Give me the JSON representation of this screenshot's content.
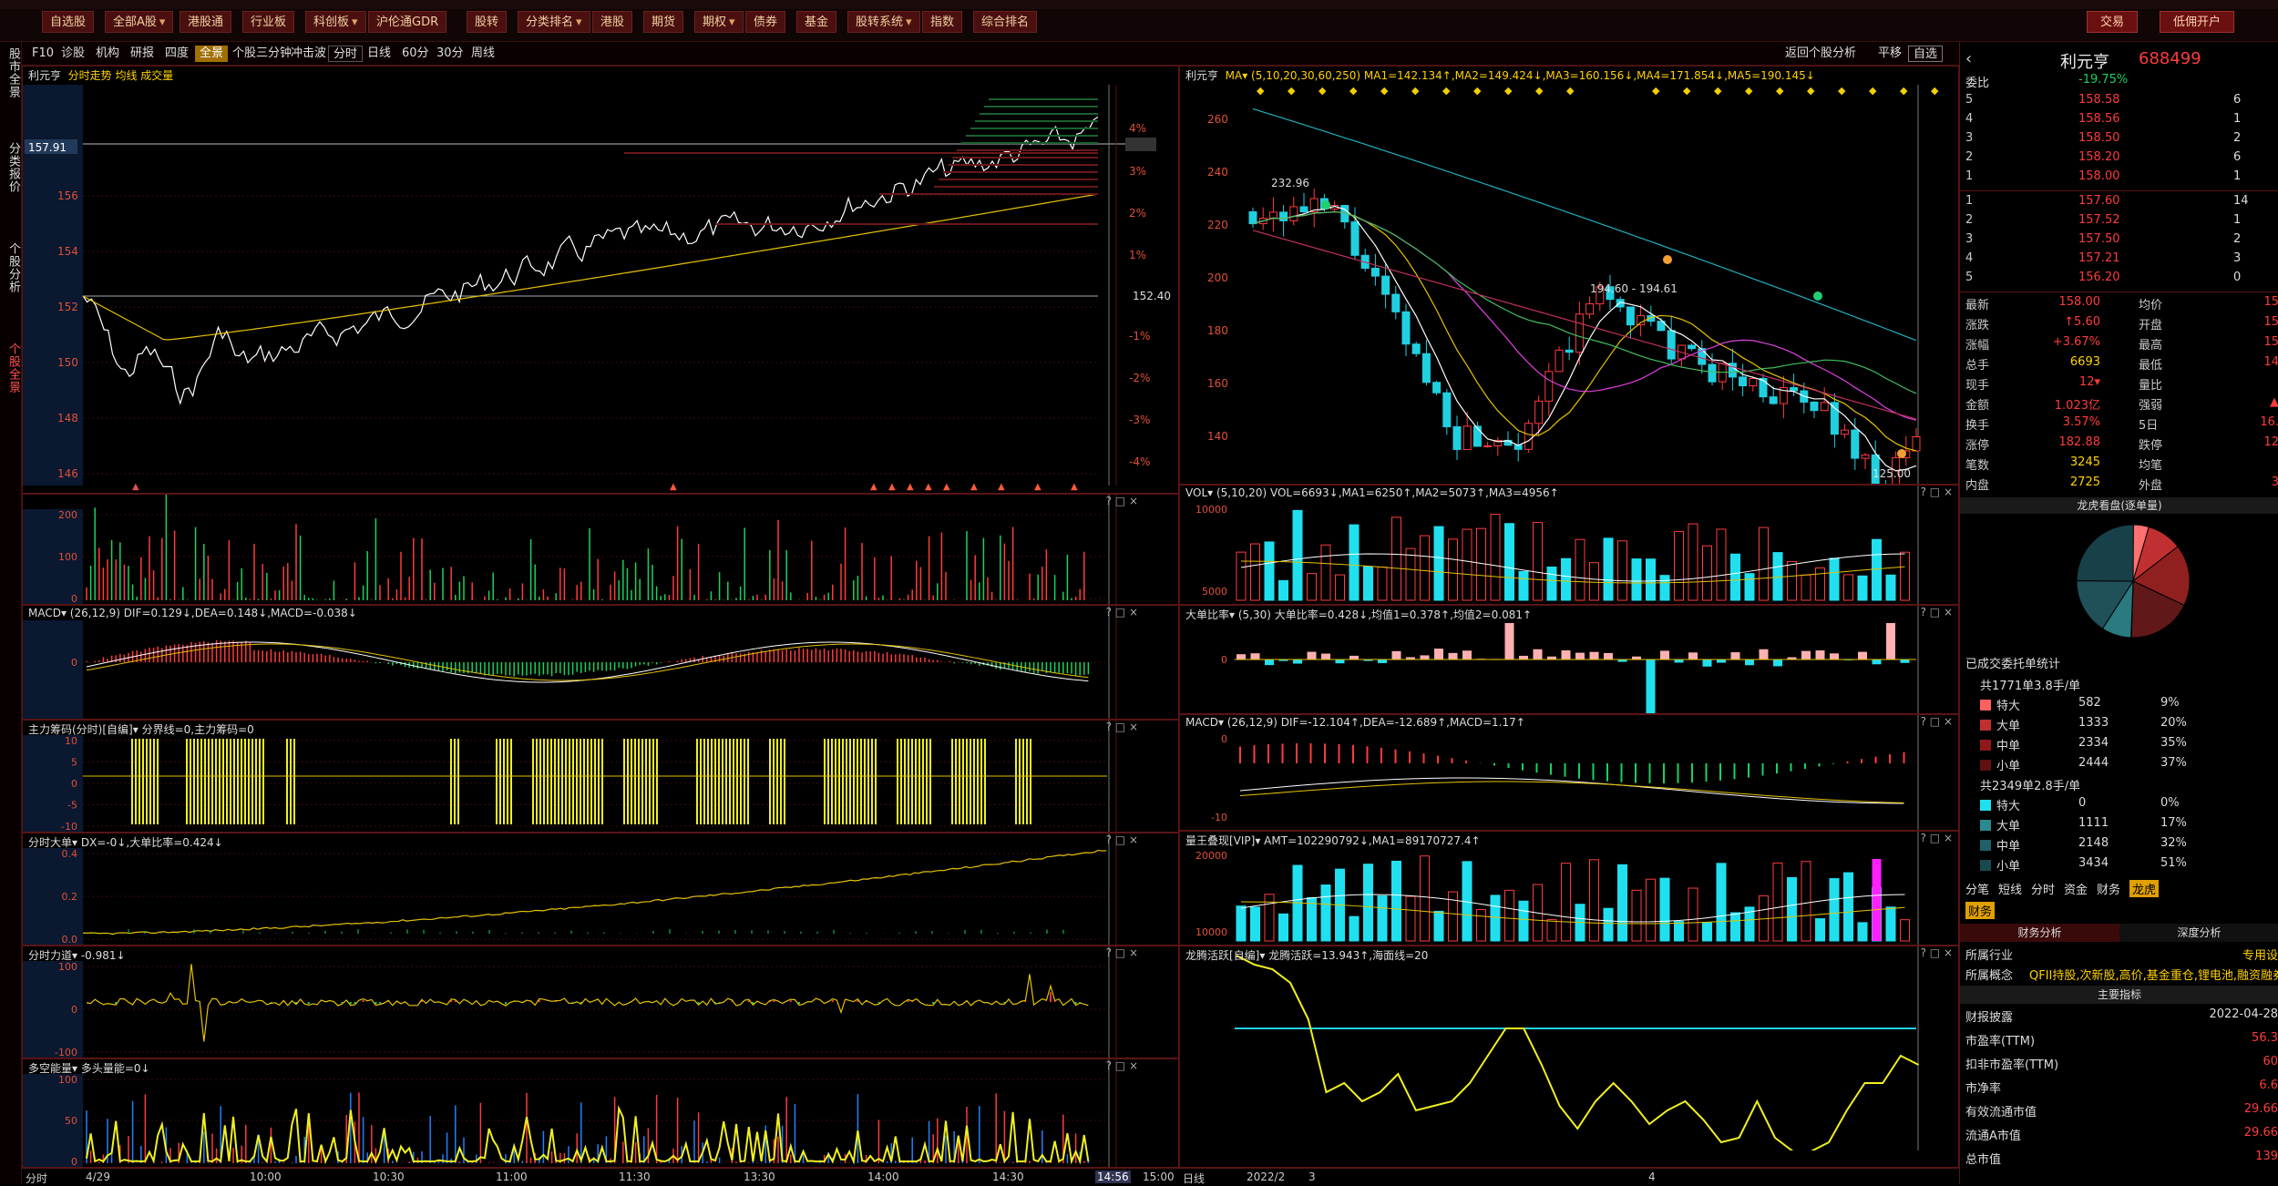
{
  "toolbar": {
    "buttons": [
      "自选股",
      "全部A股",
      "港股通",
      "行业板",
      "科创板",
      "沪伦通GDR",
      "股转",
      "分类排名",
      "港股",
      "期货",
      "期权",
      "债券",
      "基金",
      "股转系统",
      "指数",
      "综合排名"
    ],
    "trade": "交易",
    "margin": "低佣开户"
  },
  "lefttabs": [
    "股市全景",
    "分类报价",
    "个股分析",
    "个股全景"
  ],
  "subtoolbar": {
    "items": [
      "F10",
      "诊股",
      "机构",
      "研报",
      "四度",
      "全景",
      "个股三分钟",
      "冲击波"
    ],
    "periods": [
      "分时",
      "日线",
      "60分",
      "30分",
      "周线"
    ],
    "right": [
      "返回个股分析",
      "平移",
      "自选"
    ]
  },
  "intraday": {
    "name": "利元亨",
    "tabs": "分时走势 均线 成交量",
    "cur_price": "157.91",
    "ref_price": "152.40",
    "yleft": [
      "156",
      "154",
      "152",
      "150",
      "148",
      "146"
    ],
    "yright": [
      "4%",
      "3.6%",
      "3%",
      "2%",
      "1%",
      "-1%",
      "-2%",
      "-3%",
      "-4%"
    ],
    "xaxis": [
      "分时",
      "4/29",
      "10:00",
      "10:30",
      "11:00",
      "11:30",
      "13:30",
      "14:00",
      "14:30",
      "14:56",
      "15:00"
    ]
  },
  "subpanels": [
    {
      "id": "vol",
      "title": "",
      "ticks": [
        "200",
        "100",
        "0"
      ]
    },
    {
      "id": "macd",
      "title": "MACD▾ (26,12,9) DIF=0.129↓,DEA=0.148↓,MACD=-0.038↓",
      "ticks": [
        "0"
      ]
    },
    {
      "id": "chip",
      "title": "主力筹码(分时)[自编]▾ 分界线=0,主力筹码=0",
      "ticks": [
        "10",
        "5",
        "0",
        "-5",
        "-10"
      ]
    },
    {
      "id": "big",
      "title": "分时大单▾ DX=-0↓,大单比率=0.424↓",
      "ticks": [
        "0.4",
        "0.2",
        "0.0"
      ]
    },
    {
      "id": "force",
      "title": "分时力道▾ -0.981↓",
      "ticks": [
        "100",
        "0",
        "-100"
      ]
    },
    {
      "id": "dkn",
      "title": "多空能量▾ 多头量能=0↓",
      "ticks": [
        "100",
        "50",
        "0"
      ]
    }
  ],
  "kline": {
    "name": "利元亨",
    "header": "MA▾ (5,10,20,30,60,250) MA1=142.134↑,MA2=149.424↓,MA3=160.156↓,MA4=171.854↓,MA5=190.145↓",
    "yticks": [
      "260",
      "240",
      "220",
      "200",
      "180",
      "160",
      "140"
    ],
    "hi": "232.96",
    "mid": "194.60 - 194.61",
    "lo": "125.00",
    "xaxis": [
      "日线",
      "2022/2",
      "3",
      "4"
    ]
  },
  "kpanels": [
    {
      "id": "kvol",
      "title": "VOL▾ (5,10,20) VOL=6693↓,MA1=6250↑,MA2=5073↑,MA3=4956↑",
      "ticks": [
        "10000",
        "5000"
      ]
    },
    {
      "id": "kbig",
      "title": "大单比率▾ (5,30) 大单比率=0.428↓,均值1=0.378↑,均值2=0.081↑",
      "ticks": [
        "0"
      ]
    },
    {
      "id": "kmacd",
      "title": "MACD▾ (26,12,9) DIF=-12.104↑,DEA=-12.689↑,MACD=1.17↑",
      "ticks": [
        "0",
        "-10"
      ]
    },
    {
      "id": "kqn",
      "title": "量王叠现[VIP]▾ AMT=102290792↓,MA1=89170727.4↑",
      "ticks": [
        "20000",
        "10000"
      ]
    },
    {
      "id": "klt",
      "title": "龙腾活跃[自编]▾ 龙腾活跃=13.943↑,海面线=20",
      "ticks": []
    }
  ],
  "orderbook": {
    "name": "利元亨",
    "code": "688499",
    "weibi": "委比",
    "weibi_val": "-19.75%",
    "asks": [
      [
        "5",
        "158.58",
        "6"
      ],
      [
        "4",
        "158.56",
        "1"
      ],
      [
        "3",
        "158.50",
        "2"
      ],
      [
        "2",
        "158.20",
        "6"
      ],
      [
        "1",
        "158.00",
        "1"
      ]
    ],
    "bids": [
      [
        "1",
        "157.60",
        "14"
      ],
      [
        "2",
        "157.52",
        "1"
      ],
      [
        "3",
        "157.50",
        "2"
      ],
      [
        "4",
        "157.21",
        "3"
      ],
      [
        "5",
        "156.20",
        "0"
      ]
    ],
    "stats": [
      [
        "最新",
        "158.00",
        "均价",
        "15"
      ],
      [
        "涨跌",
        "↑5.60",
        "开盘",
        "15"
      ],
      [
        "涨幅",
        "+3.67%",
        "最高",
        "15"
      ],
      [
        "总手",
        "6693",
        "最低",
        "14"
      ],
      [
        "现手",
        "12▾",
        "量比",
        ""
      ],
      [
        "金额",
        "1.023亿",
        "强弱",
        "▲"
      ],
      [
        "换手",
        "3.57%",
        "5日",
        "16."
      ],
      [
        "涨停",
        "182.88",
        "跌停",
        "12"
      ],
      [
        "笔数",
        "3245",
        "均笔",
        ""
      ],
      [
        "内盘",
        "2725",
        "外盘",
        "3"
      ]
    ],
    "pie_title": "龙虎看盘(逐单量)",
    "ord_title": "已成交委托单统计",
    "buy_head": "共1771单3.8手/单",
    "buy": [
      [
        "特大",
        "582",
        "9%"
      ],
      [
        "大单",
        "1333",
        "20%"
      ],
      [
        "中单",
        "2334",
        "35%"
      ],
      [
        "小单",
        "2444",
        "37%"
      ]
    ],
    "sell_head": "共2349单2.8手/单",
    "sell": [
      [
        "特大",
        "0",
        "0%"
      ],
      [
        "大单",
        "1111",
        "17%"
      ],
      [
        "中单",
        "2148",
        "32%"
      ],
      [
        "小单",
        "3434",
        "51%"
      ]
    ],
    "tabs": [
      "分笔",
      "短线",
      "分时",
      "资金",
      "财务",
      "龙虎"
    ],
    "fin_tab": "财务",
    "fin_left": "财务分析",
    "fin_right": "深度分析",
    "industry_k": "所属行业",
    "industry_v": "专用设",
    "concept_k": "所属概念",
    "concept_v": "QFII持股,次新股,高价,基金重仓,锂电池,融资融券",
    "main_idx": "主要指标",
    "fin": [
      [
        "财报披露",
        "2022-04-28"
      ],
      [
        "市盈率(TTM)",
        "56.3"
      ],
      [
        "扣非市盈率(TTM)",
        "60"
      ],
      [
        "市净率",
        "6.6"
      ],
      [
        "有效流通市值",
        "29.66"
      ],
      [
        "流通A市值",
        "29.66"
      ],
      [
        "总市值",
        "139"
      ]
    ]
  }
}
